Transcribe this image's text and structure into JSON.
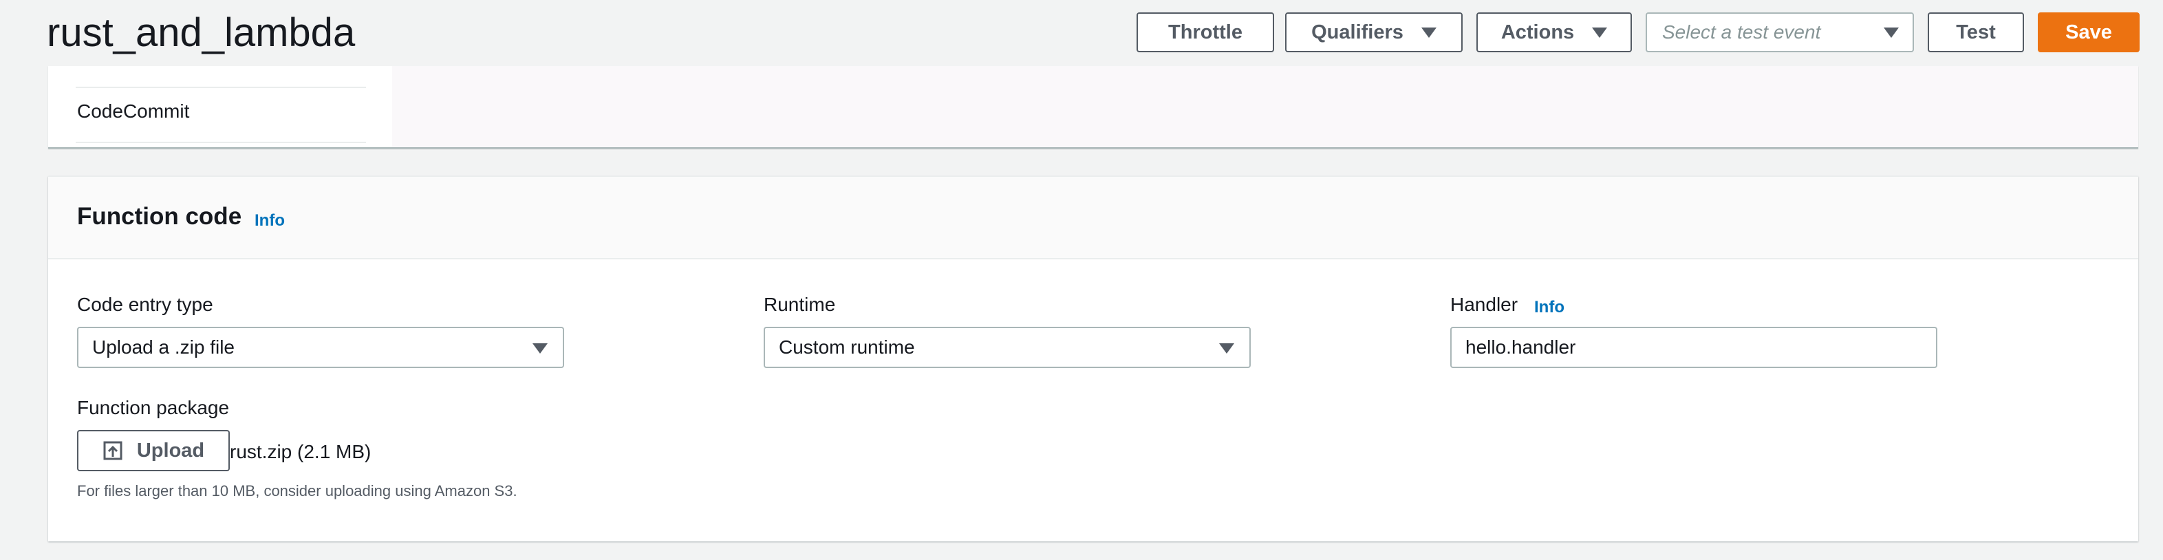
{
  "header": {
    "title": "rust_and_lambda",
    "throttle_label": "Throttle",
    "qualifiers_label": "Qualifiers",
    "actions_label": "Actions",
    "test_event_placeholder": "Select a test event",
    "test_label": "Test",
    "save_label": "Save",
    "colors": {
      "save": "#ec7211"
    }
  },
  "top_panel": {
    "sidebar_items": [
      "CodeCommit"
    ]
  },
  "function_code": {
    "title": "Function code",
    "info": "Info",
    "code_entry_type": {
      "label": "Code entry type",
      "value": "Upload a .zip file"
    },
    "runtime": {
      "label": "Runtime",
      "value": "Custom runtime"
    },
    "handler": {
      "label": "Handler",
      "info": "Info",
      "value": "hello.handler"
    },
    "function_package": {
      "label": "Function package",
      "upload_label": "Upload",
      "file_info": "rust.zip (2.1 MB)",
      "help_text": "For files larger than 10 MB, consider uploading using Amazon S3."
    }
  }
}
